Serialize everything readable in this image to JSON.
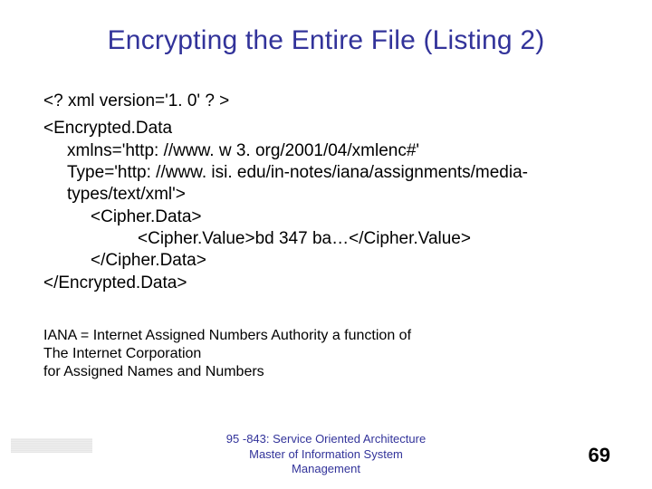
{
  "title": "Encrypting the Entire File (Listing 2)",
  "code": {
    "l1": "<? xml version='1. 0' ? >",
    "l2": "<Encrypted.Data",
    "l3": "xmlns='http: //www. w 3. org/2001/04/xmlenc#'",
    "l4": "Type='http: //www. isi. edu/in-notes/iana/assignments/media-types/text/xml'>",
    "l5": "<Cipher.Data>",
    "l6": "<Cipher.Value>bd 347 ba…</Cipher.Value>",
    "l7": "</Cipher.Data>",
    "l8": "</Encrypted.Data>"
  },
  "note": {
    "n1": "IANA = Internet Assigned Numbers Authority a function of",
    "n2": "The Internet Corporation",
    "n3": "for Assigned Names and Numbers"
  },
  "footer": {
    "course": "95 -843: Service Oriented Architecture",
    "program1": "Master of Information System",
    "program2": "Management"
  },
  "page_number": "69"
}
